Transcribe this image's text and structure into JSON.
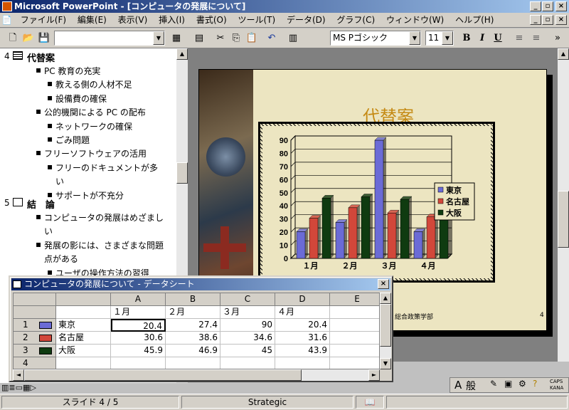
{
  "window": {
    "title": "Microsoft PowerPoint - [コンピュータの発展について]"
  },
  "menu": [
    "ファイル(F)",
    "編集(E)",
    "表示(V)",
    "挿入(I)",
    "書式(O)",
    "ツール(T)",
    "データ(D)",
    "グラフ(C)",
    "ウィンドウ(W)",
    "ヘルプ(H)"
  ],
  "toolbar": {
    "font_name": "MS Pゴシック",
    "font_size": "11",
    "bold": "B",
    "italic": "I",
    "underline": "U"
  },
  "outline": {
    "slide4_num": "4",
    "slide4_title": "代替案",
    "slide4_items": [
      {
        "level": 1,
        "text": "PC 教育の充実"
      },
      {
        "level": 2,
        "text": "教える側の人材不足"
      },
      {
        "level": 2,
        "text": "設備費の確保"
      },
      {
        "level": 1,
        "text": "公的機関による PC の配布"
      },
      {
        "level": 2,
        "text": "ネットワークの確保"
      },
      {
        "level": 2,
        "text": "ごみ問題"
      },
      {
        "level": 1,
        "text": "フリーソフトウェアの活用"
      },
      {
        "level": 2,
        "text": "フリーのドキュメントが多"
      },
      {
        "level": 3,
        "text": "い"
      },
      {
        "level": 2,
        "text": "サポートが不充分"
      }
    ],
    "slide5_num": "5",
    "slide5_title": "結　論",
    "slide5_items": [
      {
        "level": 1,
        "text": "コンピュータの発展はめざまし"
      },
      {
        "level": 4,
        "text": "い"
      },
      {
        "level": 1,
        "text": "発展の影には、さまざまな問題"
      },
      {
        "level": 4,
        "text": "点がある"
      },
      {
        "level": 2,
        "text": "ユーザの操作方法の習得"
      }
    ]
  },
  "slide": {
    "title": "代替案",
    "footer": "総合政策学部",
    "page": "4"
  },
  "chart_data": {
    "type": "bar",
    "categories": [
      "１月",
      "２月",
      "３月",
      "４月"
    ],
    "series": [
      {
        "name": "東京",
        "values": [
          20.4,
          27.4,
          90,
          20.4
        ],
        "color": "#6b6bd6"
      },
      {
        "name": "名古屋",
        "values": [
          30.6,
          38.6,
          34.6,
          31.6
        ],
        "color": "#d2473a"
      },
      {
        "name": "大阪",
        "values": [
          45.9,
          46.9,
          45,
          43.9
        ],
        "color": "#0f3b10"
      }
    ],
    "ylim": [
      0,
      90
    ],
    "yticks": [
      "0",
      "10",
      "20",
      "30",
      "40",
      "50",
      "60",
      "70",
      "80",
      "90"
    ],
    "legend": "right",
    "grid": true
  },
  "datasheet": {
    "title": "コンピュータの発展について - データシート",
    "columns": [
      "A",
      "B",
      "C",
      "D",
      "E"
    ],
    "header_row": [
      "１月",
      "２月",
      "３月",
      "４月"
    ],
    "rows": [
      {
        "num": "1",
        "label": "東京",
        "values": [
          "20.4",
          "27.4",
          "90",
          "20.4"
        ]
      },
      {
        "num": "2",
        "label": "名古屋",
        "values": [
          "30.6",
          "38.6",
          "34.6",
          "31.6"
        ]
      },
      {
        "num": "3",
        "label": "大阪",
        "values": [
          "45.9",
          "46.9",
          "45",
          "43.9"
        ]
      },
      {
        "num": "4",
        "label": "",
        "values": [
          "",
          "",
          "",
          ""
        ]
      }
    ]
  },
  "status": {
    "slide": "スライド 4 / 5",
    "design": "Strategic"
  },
  "ime": {
    "mode": "般",
    "caps": "CAPS",
    "kana": "KANA"
  }
}
